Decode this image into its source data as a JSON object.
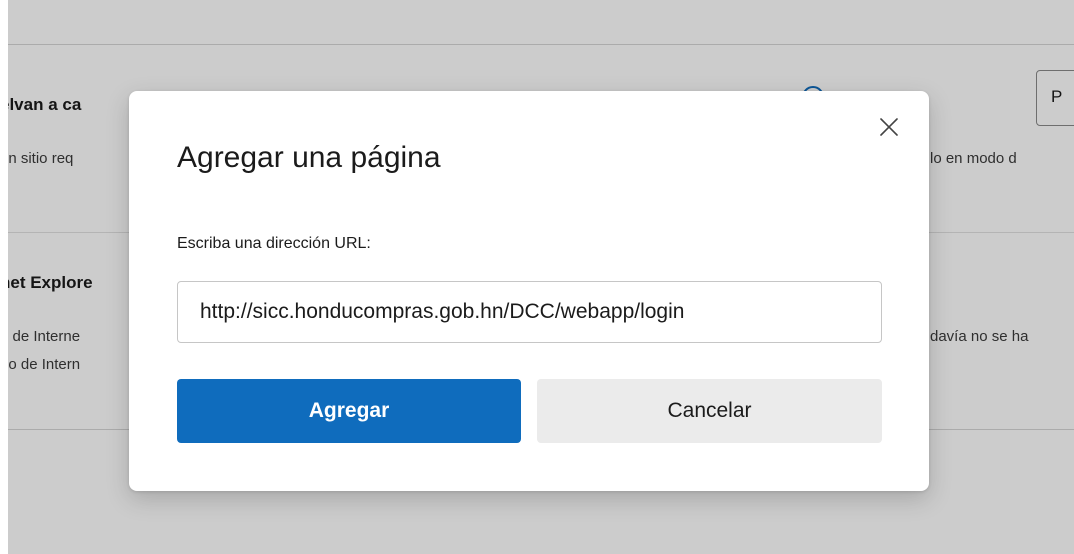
{
  "background": {
    "section1": {
      "heading_fragment": "elvan a ca",
      "desc_left": "un sitio req",
      "desc_right": "lo en modo d",
      "button_fragment": "P"
    },
    "section2": {
      "heading_fragment": "net Explore",
      "desc_left_line1": "o de Interne",
      "desc_left_line2": "do de Intern",
      "desc_right": "davía no se ha"
    }
  },
  "dialog": {
    "title": "Agregar una página",
    "url_label": "Escriba una dirección URL:",
    "url_value": "http://sicc.honducompras.gob.hn/DCC/webapp/login",
    "add_label": "Agregar",
    "cancel_label": "Cancelar",
    "close_icon": "close-icon"
  },
  "colors": {
    "primary": "#0f6cbd",
    "secondary_button": "#ebebeb",
    "overlay": "rgba(0,0,0,0.20)"
  }
}
